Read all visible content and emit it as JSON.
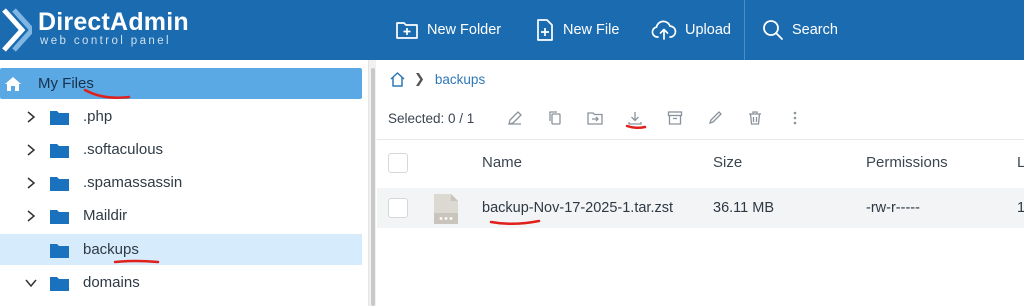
{
  "brand": {
    "title": "DirectAdmin",
    "subtitle": "web control panel",
    "color": "#1b6bb0"
  },
  "topbar": {
    "buttons": [
      {
        "label": "New Folder",
        "icon": "folder-plus-icon"
      },
      {
        "label": "New File",
        "icon": "file-plus-icon"
      },
      {
        "label": "Upload",
        "icon": "cloud-upload-icon"
      },
      {
        "label": "Search",
        "icon": "search-icon"
      }
    ]
  },
  "sidebar": {
    "items": [
      {
        "label": "My Files",
        "icon": "home-icon",
        "state": "active"
      },
      {
        "label": ".php",
        "icon": "folder-icon",
        "chevron": "right"
      },
      {
        "label": ".softaculous",
        "icon": "folder-icon",
        "chevron": "right"
      },
      {
        "label": ".spamassassin",
        "icon": "folder-icon",
        "chevron": "right"
      },
      {
        "label": "Maildir",
        "icon": "folder-icon",
        "chevron": "right"
      },
      {
        "label": "backups",
        "icon": "folder-icon",
        "state": "selected"
      },
      {
        "label": "domains",
        "icon": "folder-icon",
        "chevron": "down"
      }
    ]
  },
  "breadcrumb": {
    "home_icon": "home-icon",
    "current": "backups"
  },
  "toolbar": {
    "selected_text": "Selected: 0 / 1",
    "actions": [
      "edit-icon",
      "copy-icon",
      "move-icon",
      "download-icon",
      "archive-icon",
      "rename-icon",
      "delete-icon",
      "more-icon"
    ]
  },
  "table": {
    "columns": [
      "Name",
      "Size",
      "Permissions",
      "L"
    ],
    "rows": [
      {
        "name": "backup-Nov-17-2025-1.tar.zst",
        "size": "36.11 MB",
        "permissions": "-rw-r-----",
        "extra": "1"
      }
    ]
  },
  "colors": {
    "accent": "#1b6bb0",
    "active_row": "#5aa8e4",
    "selected_row": "#d6ebfb",
    "annotation": "#e0201b"
  }
}
